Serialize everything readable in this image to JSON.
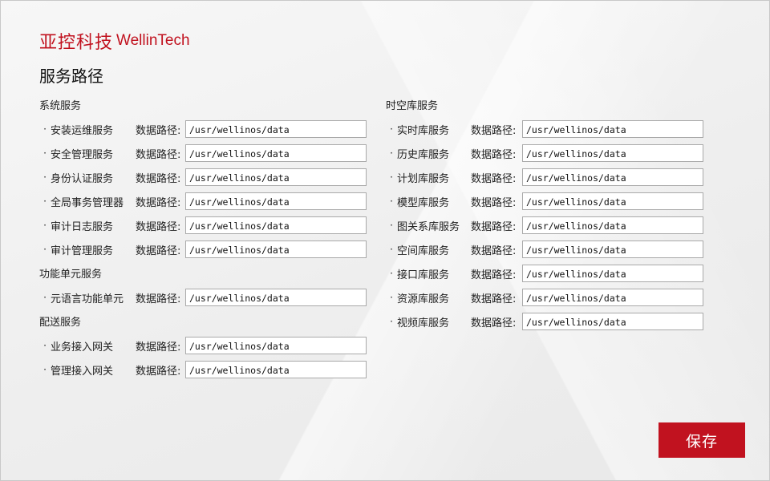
{
  "brand": {
    "cn": "亚控科技",
    "en": "WellinTech"
  },
  "page": {
    "title": "服务路径"
  },
  "path_label": "数据路径:",
  "groups": {
    "system": {
      "title": "系统服务",
      "items": [
        {
          "name": "安装运维服务",
          "path": "/usr/wellinos/data"
        },
        {
          "name": "安全管理服务",
          "path": "/usr/wellinos/data"
        },
        {
          "name": "身份认证服务",
          "path": "/usr/wellinos/data"
        },
        {
          "name": "全局事务管理器",
          "path": "/usr/wellinos/data"
        },
        {
          "name": "审计日志服务",
          "path": "/usr/wellinos/data"
        },
        {
          "name": "审计管理服务",
          "path": "/usr/wellinos/data"
        }
      ]
    },
    "function_unit": {
      "title": "功能单元服务",
      "items": [
        {
          "name": "元语言功能单元",
          "path": "/usr/wellinos/data"
        }
      ]
    },
    "delivery": {
      "title": "配送服务",
      "items": [
        {
          "name": "业务接入网关",
          "path": "/usr/wellinos/data"
        },
        {
          "name": "管理接入网关",
          "path": "/usr/wellinos/data"
        }
      ]
    },
    "spatiotemporal": {
      "title": "时空库服务",
      "items": [
        {
          "name": "实时库服务",
          "path": "/usr/wellinos/data"
        },
        {
          "name": "历史库服务",
          "path": "/usr/wellinos/data"
        },
        {
          "name": "计划库服务",
          "path": "/usr/wellinos/data"
        },
        {
          "name": "模型库服务",
          "path": "/usr/wellinos/data"
        },
        {
          "name": "图关系库服务",
          "path": "/usr/wellinos/data"
        },
        {
          "name": "空间库服务",
          "path": "/usr/wellinos/data"
        },
        {
          "name": "接口库服务",
          "path": "/usr/wellinos/data"
        },
        {
          "name": "资源库服务",
          "path": "/usr/wellinos/data"
        },
        {
          "name": "视频库服务",
          "path": "/usr/wellinos/data"
        }
      ]
    }
  },
  "actions": {
    "save_label": "保存"
  },
  "colors": {
    "brand_red": "#c1121f",
    "background": "#f0f0f0"
  }
}
